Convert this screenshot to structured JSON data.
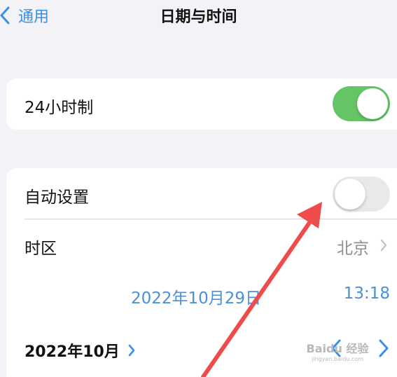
{
  "nav": {
    "back_label": "通用",
    "title": "日期与时间"
  },
  "section1": {
    "label": "24小时制",
    "toggle_on": true
  },
  "section2": {
    "auto_label": "自动设置",
    "auto_toggle_on": false,
    "timezone_label": "时区",
    "timezone_value": "北京",
    "date_value": "2022年10月29日",
    "time_value": "13:18"
  },
  "calendar": {
    "month_label": "2022年10月"
  },
  "watermark": {
    "text": "Baidu 经验",
    "url": "jingyan.baidu.com"
  },
  "colors": {
    "accent": "#3a8fe8",
    "toggle_on": "#65c466",
    "toggle_off": "#e9e9eb",
    "annotation_arrow": "#ee4b4b"
  }
}
